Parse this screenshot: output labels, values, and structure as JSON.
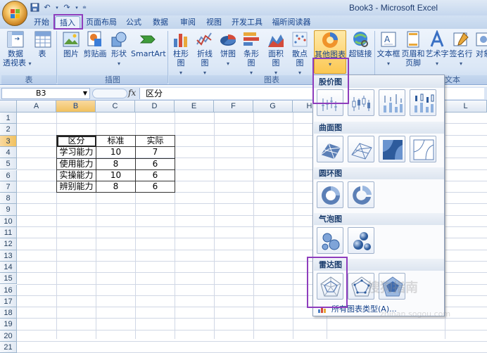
{
  "window": {
    "title": "Book3 - Microsoft Excel"
  },
  "qat": {
    "icons": [
      "save-icon",
      "undo-icon",
      "redo-icon"
    ]
  },
  "tabs": [
    {
      "label": "开始"
    },
    {
      "label": "插入",
      "active": true
    },
    {
      "label": "页面布局"
    },
    {
      "label": "公式"
    },
    {
      "label": "数据"
    },
    {
      "label": "审阅"
    },
    {
      "label": "视图"
    },
    {
      "label": "开发工具"
    },
    {
      "label": "福昕阅读器"
    }
  ],
  "ribbon": {
    "groups": {
      "tables": "表",
      "illustrations": "插图",
      "charts": "图表",
      "text": "文本"
    },
    "buttons": {
      "pivot": "数据\n透视表",
      "table": "表",
      "picture": "图片",
      "clipart": "剪贴画",
      "shapes": "形状",
      "smartart": "SmartArt",
      "column": "柱形图",
      "line": "折线图",
      "pie": "饼图",
      "bar": "条形图",
      "area": "面积图",
      "scatter": "散点图",
      "other": "其他图表",
      "hyperlink": "超链接",
      "textbox": "文本框",
      "header": "页眉和\n页脚",
      "wordart": "艺术字",
      "signature": "签名行",
      "object": "对象"
    }
  },
  "formula_bar": {
    "name_box": "B3",
    "fx": "fx",
    "content": "区分"
  },
  "columns": [
    "A",
    "B",
    "C",
    "D",
    "E",
    "F",
    "G",
    "H",
    "I",
    "J",
    "K",
    "L"
  ],
  "rows": [
    "1",
    "2",
    "3",
    "4",
    "5",
    "6",
    "7",
    "8",
    "9",
    "10",
    "11",
    "12",
    "13",
    "14",
    "15",
    "16",
    "17",
    "18",
    "19",
    "20",
    "21"
  ],
  "table": {
    "header": [
      "区分",
      "标准",
      "实际"
    ],
    "rows": [
      [
        "学习能力",
        "10",
        "7"
      ],
      [
        "使用能力",
        "8",
        "6"
      ],
      [
        "实操能力",
        "10",
        "6"
      ],
      [
        "辨别能力",
        "8",
        "6"
      ]
    ]
  },
  "dropdown": {
    "sections": {
      "stock": "股价图",
      "surface": "曲面图",
      "doughnut": "圆环图",
      "bubble": "气泡图",
      "radar": "雷达图"
    },
    "all_types": "所有图表类型(A)..."
  },
  "watermark": {
    "text": "搜狗指南",
    "sub": "zhinan.sogou.com"
  },
  "colors": {
    "highlight": "#8e3dbd",
    "selected_header": "#f1c15f"
  }
}
